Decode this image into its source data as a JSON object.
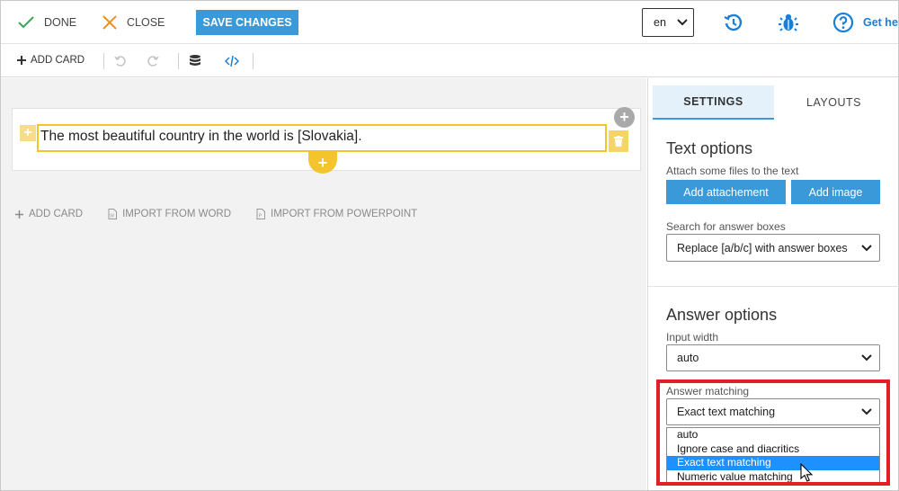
{
  "topbar": {
    "done_label": "DONE",
    "close_label": "CLOSE",
    "save_label": "SAVE CHANGES",
    "language_value": "en",
    "help_label": "Get he"
  },
  "toolbar": {
    "add_card_label": "ADD CARD"
  },
  "card": {
    "text": "The most beautiful country in the world is [Slovakia]."
  },
  "main_actions": {
    "add_card": "ADD CARD",
    "import_word": "IMPORT FROM WORD",
    "import_powerpoint": "IMPORT FROM POWERPOINT"
  },
  "panel": {
    "tabs": [
      {
        "label": "SETTINGS",
        "active": true
      },
      {
        "label": "LAYOUTS",
        "active": false
      }
    ],
    "text_options": {
      "title": "Text options",
      "attach_subtitle": "Attach some files to the text",
      "add_attachment_label": "Add attachement",
      "add_image_label": "Add image",
      "search_label": "Search for answer boxes",
      "search_value": "Replace [a/b/c] with answer boxes"
    },
    "answer_options": {
      "title": "Answer options",
      "input_width_label": "Input width",
      "input_width_value": "auto",
      "matching_label": "Answer matching",
      "matching_value": "Exact text matching",
      "matching_options": [
        {
          "label": "auto",
          "selected": false
        },
        {
          "label": "Ignore case and diacritics",
          "selected": false
        },
        {
          "label": "Exact text matching",
          "selected": true
        },
        {
          "label": "Numeric value matching",
          "selected": false
        }
      ]
    }
  },
  "colors": {
    "accent": "#3a99d8",
    "highlight_border": "#e41e26",
    "card_outline": "#f3c42b",
    "done_check": "#3aa655",
    "close_x": "#f08c1e"
  }
}
